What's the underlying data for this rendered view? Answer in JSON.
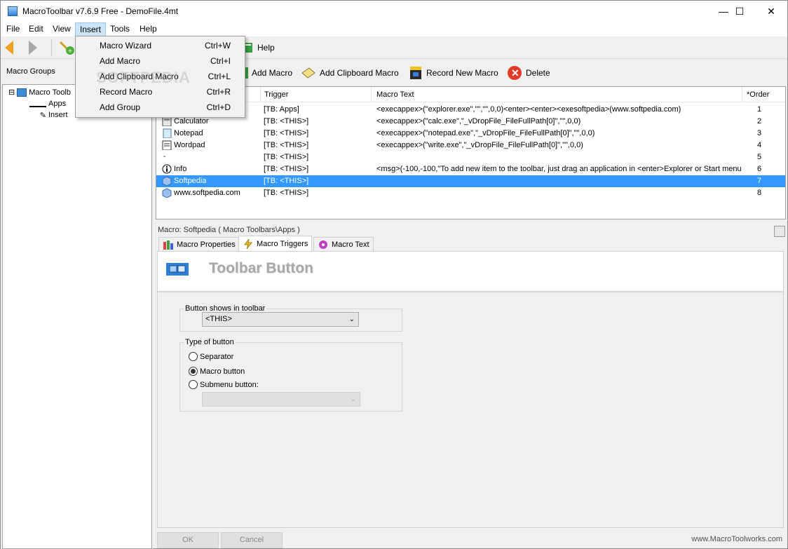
{
  "window": {
    "title": "MacroToolbar v7.6.9 Free - DemoFile.4mt",
    "minimize": "—",
    "maximize": "☐",
    "close": "✕"
  },
  "menubar": [
    "File",
    "Edit",
    "View",
    "Insert",
    "Tools",
    "Help"
  ],
  "toolbar": {
    "help": "Help"
  },
  "left_pane": {
    "header": "Macro Groups",
    "tree": [
      {
        "label": "Macro Toolb",
        "expander": "⊟"
      },
      {
        "label": "Apps"
      },
      {
        "label": "Insert"
      }
    ]
  },
  "actions": {
    "add_macro": "Add Macro",
    "add_clipboard": "Add Clipboard Macro",
    "record": "Record New Macro",
    "delete": "Delete"
  },
  "grid": {
    "columns": [
      "Trigger",
      "Macro Text",
      "*Order"
    ],
    "rows": [
      {
        "name": "",
        "trigger": "[TB: Apps]",
        "text": "<execappex>(\"explorer.exe\",\"\",\"\",0,0)<enter><enter><exesoftpedia>(www.softpedia.com)",
        "order": "1"
      },
      {
        "name": "Calculator",
        "trigger": "[TB: <THIS>]",
        "text": "<execappex>(\"calc.exe\",\"_vDropFile_FileFullPath[0]\",\"\",0,0)",
        "order": "2"
      },
      {
        "name": "Notepad",
        "trigger": "[TB: <THIS>]",
        "text": "<execappex>(\"notepad.exe\",\"_vDropFile_FileFullPath[0]\",\"\",0,0)",
        "order": "3"
      },
      {
        "name": "Wordpad",
        "trigger": "[TB: <THIS>]",
        "text": "<execappex>(\"write.exe\",\"_vDropFile_FileFullPath[0]\",\"\",0,0)",
        "order": "4"
      },
      {
        "name": "",
        "trigger": "[TB: <THIS>]",
        "text": "",
        "order": "5"
      },
      {
        "name": "Info",
        "trigger": "[TB: <THIS>]",
        "text": "<msg>(-100,-100,\"To add new item to the toolbar, just drag an application in <enter>Explorer or Start menu ...",
        "order": "6"
      },
      {
        "name": "Softpedia",
        "trigger": "[TB: <THIS>]",
        "text": "",
        "order": "7"
      },
      {
        "name": "www.softpedia.com",
        "trigger": "[TB: <THIS>]",
        "text": "",
        "order": "8"
      }
    ]
  },
  "details": {
    "macro_label": "Macro: Softpedia ( Macro Toolbars\\Apps )",
    "tabs": [
      "Macro Properties",
      "Macro Triggers",
      "Macro Text"
    ],
    "section_title": "Toolbar Button",
    "button_shows_label": "Button shows in toolbar",
    "button_shows_value": "<THIS>",
    "type_label": "Type of button",
    "radio_separator": "Separator",
    "radio_macro": "Macro button",
    "radio_submenu": "Submenu button:",
    "ok": "OK",
    "cancel": "Cancel",
    "link": "www.MacroToolworks.com"
  },
  "insert_menu": [
    {
      "label": "Macro Wizard",
      "shortcut": "Ctrl+W"
    },
    {
      "label": "Add Macro",
      "shortcut": "Ctrl+I"
    },
    {
      "label": "Add Clipboard Macro",
      "shortcut": "Ctrl+L"
    },
    {
      "label": "Record Macro",
      "shortcut": "Ctrl+R"
    },
    {
      "label": "Add Group",
      "shortcut": "Ctrl+D"
    }
  ],
  "watermark": "SOFTPEDIA",
  "colors": {
    "selection": "#3399ff",
    "menu_open": "#cce4f7",
    "delete_red": "#e03a2a"
  }
}
